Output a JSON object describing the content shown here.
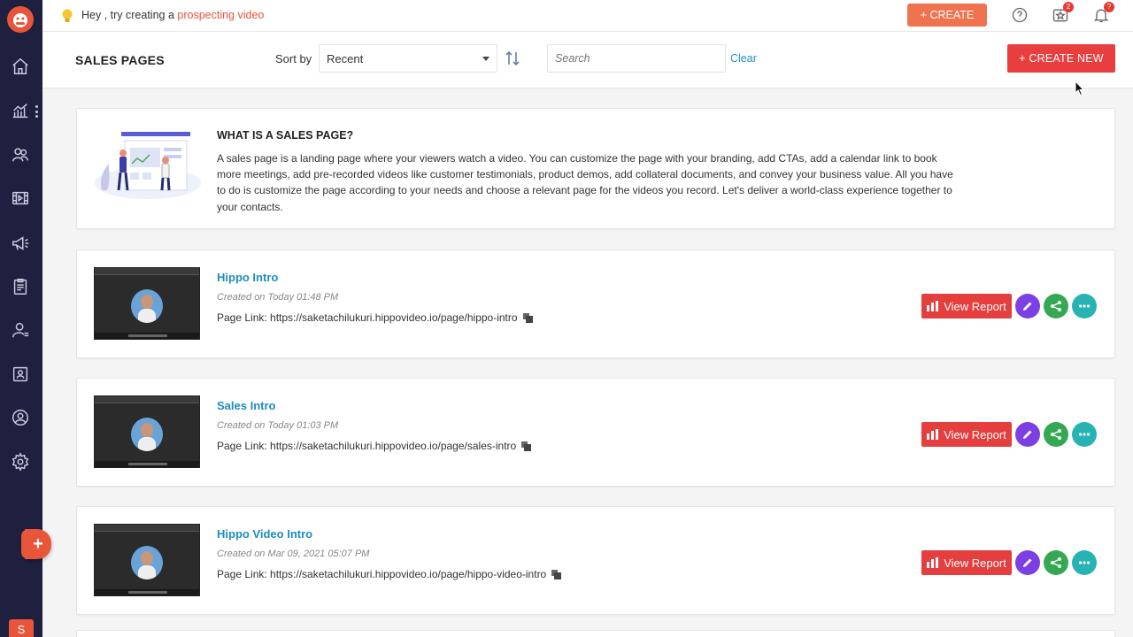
{
  "topbar": {
    "tip_prefix": "Hey , try creating a ",
    "tip_highlight": "prospecting video",
    "create_label": "+ CREATE",
    "notifications": [
      {
        "icon": "star-icon",
        "count": "2"
      },
      {
        "icon": "bell-icon",
        "count": "?"
      }
    ]
  },
  "header": {
    "title": "SALES PAGES",
    "sort_label": "Sort by",
    "sort_value": "Recent",
    "search_placeholder": "Search",
    "clear_label": "Clear",
    "create_new_label": "+ CREATE NEW"
  },
  "info": {
    "title": "WHAT IS A SALES PAGE?",
    "text": "A sales page is a landing page where your viewers watch a video. You can customize the page with your branding, add CTAs, add a calendar link to book more meetings, add pre-recorded videos like customer testimonials, product demos, add collateral documents, and convey your business value. All you have to do is customize the page according to your needs and choose a relevant page for the videos you record. Let's deliver a world-class experience together to your contacts."
  },
  "pages": [
    {
      "title": "Hippo Intro",
      "created": "Created on Today 01:48 PM",
      "link": "Page Link: https://saketachilukuri.hippovideo.io/page/hippo-intro",
      "report_label": "View Report"
    },
    {
      "title": "Sales Intro",
      "created": "Created on Today 01:03 PM",
      "link": "Page Link: https://saketachilukuri.hippovideo.io/page/sales-intro",
      "report_label": "View Report"
    },
    {
      "title": "Hippo Video Intro",
      "created": "Created on Mar 09, 2021 05:07 PM",
      "link": "Page Link: https://saketachilukuri.hippovideo.io/page/hippo-video-intro",
      "report_label": "View Report"
    }
  ],
  "sidebar": {
    "items": [
      "home-icon",
      "analytics-icon",
      "contacts-icon",
      "video-icon",
      "campaign-icon",
      "pages-icon",
      "user-icon",
      "contact-card-icon",
      "profile-icon",
      "settings-icon"
    ],
    "user_initial": "S"
  },
  "colors": {
    "accent": "#e8553a",
    "primary_button": "#e83e3e",
    "link": "#1e8cbf",
    "sidebar_bg": "#1f1f3f"
  }
}
